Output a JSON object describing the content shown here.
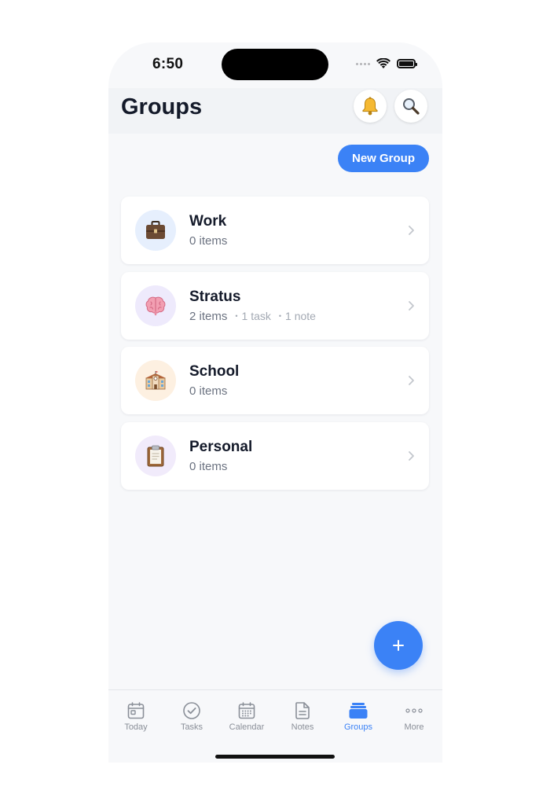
{
  "status_bar": {
    "time": "6:50"
  },
  "header": {
    "title": "Groups",
    "bell_icon": "bell-icon",
    "search_icon": "magnifier-icon"
  },
  "actions": {
    "new_group_label": "New Group",
    "fab_label": "+"
  },
  "groups": [
    {
      "name": "Work",
      "count": "0 items",
      "extra": [],
      "icon": "briefcase-icon",
      "avatar_bg": "#e6effd"
    },
    {
      "name": "Stratus",
      "count": "2 items",
      "extra": [
        "1 task",
        "1 note"
      ],
      "icon": "brain-icon",
      "avatar_bg": "#eeeafc"
    },
    {
      "name": "School",
      "count": "0 items",
      "extra": [],
      "icon": "school-icon",
      "avatar_bg": "#fdf0e1"
    },
    {
      "name": "Personal",
      "count": "0 items",
      "extra": [],
      "icon": "clipboard-icon",
      "avatar_bg": "#f1ebfb"
    }
  ],
  "tabs": [
    {
      "label": "Today",
      "icon": "today-icon",
      "active": false
    },
    {
      "label": "Tasks",
      "icon": "check-circle-icon",
      "active": false
    },
    {
      "label": "Calendar",
      "icon": "calendar-icon",
      "active": false
    },
    {
      "label": "Notes",
      "icon": "note-icon",
      "active": false
    },
    {
      "label": "Groups",
      "icon": "groups-icon",
      "active": true
    },
    {
      "label": "More",
      "icon": "more-icon",
      "active": false
    }
  ],
  "colors": {
    "accent": "#3b82f6",
    "background": "#f7f8fa",
    "header_background": "#f1f3f6",
    "title_text": "#141a2a",
    "muted_text": "#6b7280",
    "tab_inactive": "#8a8f98"
  }
}
